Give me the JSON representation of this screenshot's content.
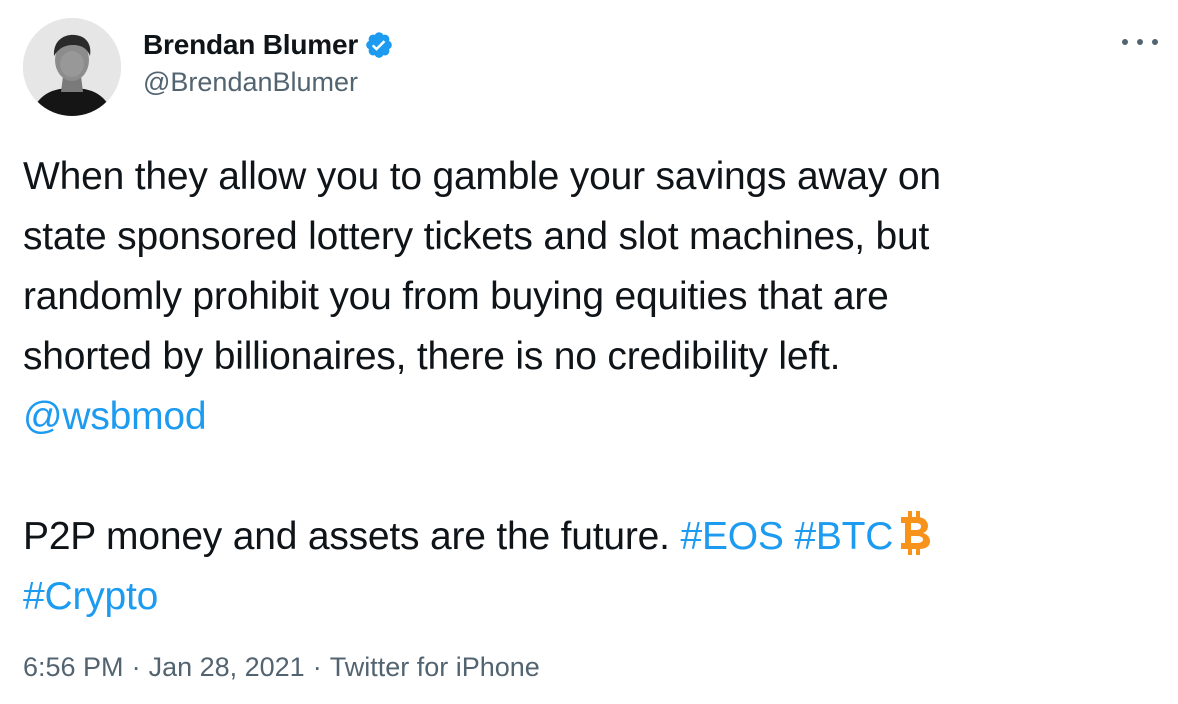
{
  "user": {
    "display_name": "Brendan Blumer",
    "handle": "@BrendanBlumer",
    "verified": true,
    "avatar_icon": "profile-photo"
  },
  "tweet": {
    "lines": [
      "When they allow you to gamble your savings away on",
      "state sponsored lottery tickets and slot machines, but",
      "randomly prohibit you from buying equities that are",
      "shorted by billionaires, there is no credibility left."
    ],
    "mention": "@wsbmod",
    "line2_text": "P2P money and assets are the future. ",
    "hashtag_eos": "#EOS",
    "hashtag_btc": "#BTC",
    "btc_icon": "bitcoin-icon",
    "hashtag_crypto": "#Crypto"
  },
  "meta": {
    "time": "6:56 PM",
    "separator": "·",
    "date": "Jan 28, 2021",
    "source": "Twitter for iPhone"
  },
  "colors": {
    "link": "#1d9bf0",
    "secondary_text": "#536471",
    "primary_text": "#0f1419",
    "bitcoin": "#f7931a"
  }
}
